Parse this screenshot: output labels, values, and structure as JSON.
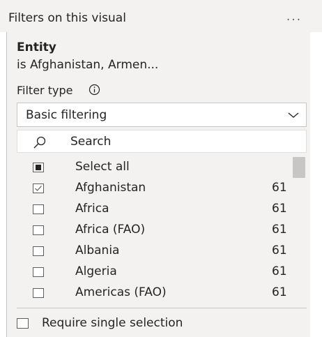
{
  "pane": {
    "title": "Filters on this visual",
    "more_icon": "more-icon",
    "more_label": "..."
  },
  "filter_card": {
    "field_name": "Entity",
    "summary": "is Afghanistan, Armen...",
    "filter_type_label": "Filter type",
    "info_icon": "info-icon",
    "filter_type_value": "Basic filtering",
    "search_placeholder": "Search",
    "select_all_label": "Select all",
    "items": [
      {
        "label": "Afghanistan",
        "count": "61",
        "checked": true
      },
      {
        "label": "Africa",
        "count": "61",
        "checked": false
      },
      {
        "label": "Africa (FAO)",
        "count": "61",
        "checked": false
      },
      {
        "label": "Albania",
        "count": "61",
        "checked": false
      },
      {
        "label": "Algeria",
        "count": "61",
        "checked": false
      },
      {
        "label": "Americas (FAO)",
        "count": "61",
        "checked": false
      }
    ],
    "require_single_label": "Require single selection"
  },
  "colors": {
    "pane_background": "#f3f2f1",
    "text": "#252423",
    "border": "#c8c6c4"
  }
}
